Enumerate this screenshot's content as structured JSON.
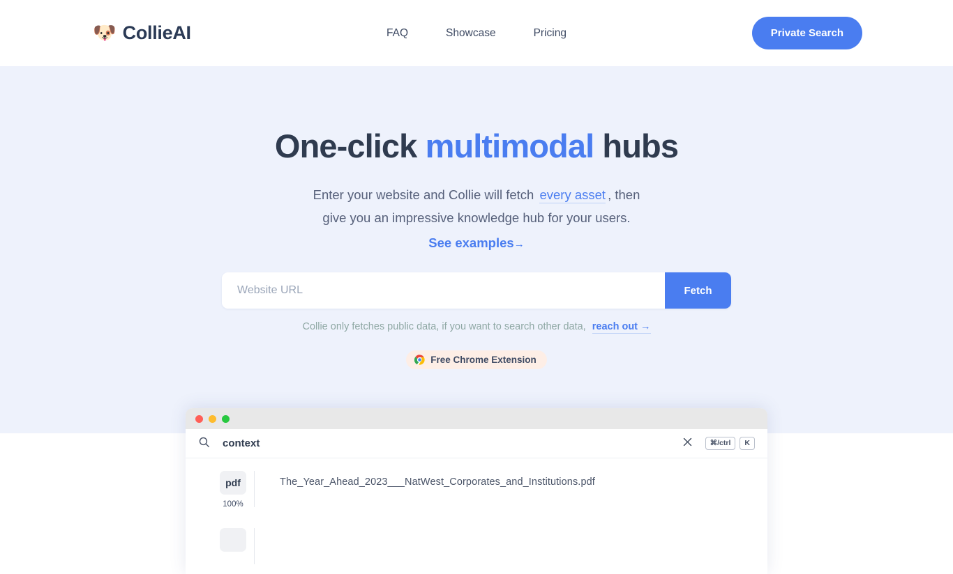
{
  "header": {
    "logo": {
      "emoji": "🐶",
      "icon": "dog-face-icon",
      "text": "CollieAI"
    },
    "nav": [
      {
        "label": "FAQ"
      },
      {
        "label": "Showcase"
      },
      {
        "label": "Pricing"
      }
    ],
    "cta": {
      "label": "Private Search",
      "color": "#4a7df0"
    }
  },
  "hero": {
    "headline": {
      "before": "One-click ",
      "accent": "multimodal",
      "after": " hubs"
    },
    "subtitle": {
      "line1_before": "Enter your website and Collie will fetch",
      "link": "every asset",
      "line1_after": ", then",
      "line2": "give you an impressive knowledge hub for your users."
    },
    "see_examples": {
      "label": "See examples",
      "arrow": "→"
    },
    "search": {
      "placeholder": "Website URL",
      "value": "",
      "button_label": "Fetch"
    },
    "disclaimer": {
      "text": "Collie only fetches public data, if you want to search other data,",
      "link": "reach out",
      "arrow": "→"
    },
    "extension_badge": {
      "icon": "chrome-icon",
      "label": "Free Chrome Extension",
      "background": "#fdeee6"
    },
    "background": "#eef2fc"
  },
  "mockup": {
    "traffic_lights": [
      "#ff5f57",
      "#febc2e",
      "#28c840"
    ],
    "search": {
      "icon": "search-icon",
      "query": "context",
      "close_icon": "close-icon",
      "shortcut": [
        "⌘/ctrl",
        "K"
      ]
    },
    "results": [
      {
        "type": "pdf",
        "match": "100%",
        "title": "The_Year_Ahead_2023___NatWest_Corporates_and_Institutions.pdf"
      },
      {
        "type": "",
        "match": "",
        "title": ""
      }
    ]
  }
}
